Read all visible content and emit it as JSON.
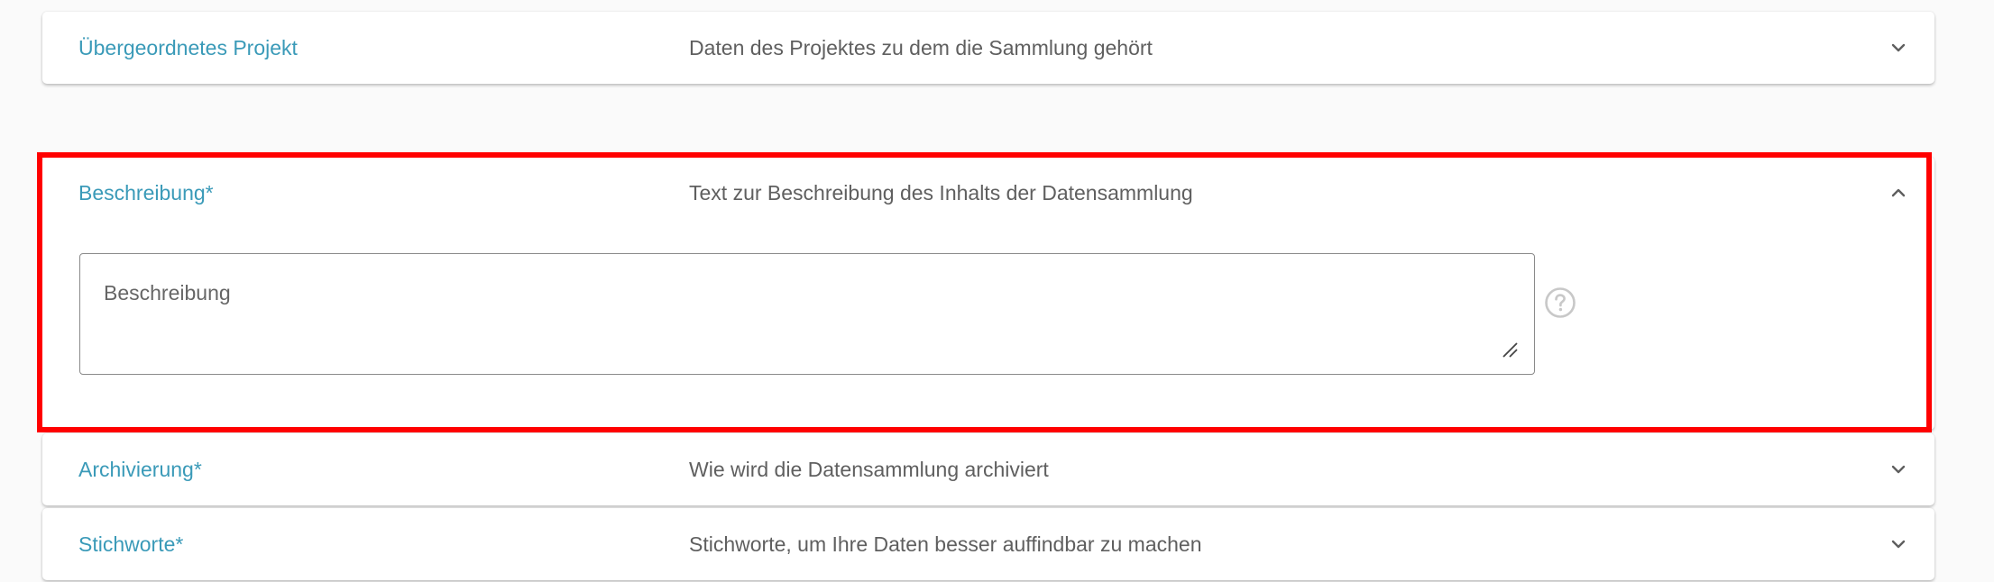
{
  "panels": {
    "project": {
      "title": "Übergeordnetes Projekt",
      "description": "Daten des Projektes zu dem die Sammlung gehört",
      "expanded": false
    },
    "description": {
      "title": "Beschreibung*",
      "description": "Text zur Beschreibung des Inhalts der Datensammlung",
      "expanded": true,
      "textarea": {
        "placeholder": "Beschreibung",
        "value": ""
      }
    },
    "archiving": {
      "title": "Archivierung*",
      "description": "Wie wird die Datensammlung archiviert",
      "expanded": false
    },
    "keywords": {
      "title": "Stichworte*",
      "description": "Stichworte, um Ihre Daten besser auffindbar zu machen",
      "expanded": false
    }
  },
  "icons": {
    "collapsed_chevron": "chevron-down-icon",
    "expanded_chevron": "chevron-up-icon",
    "help": "help-circle-icon",
    "resize": "resize-handle-icon"
  },
  "colors": {
    "title": "#3a9ab8",
    "description": "#5f5f5f",
    "highlight": "#ff0000",
    "icon": "#5f5f5f",
    "help_icon": "#c8c8c8"
  }
}
